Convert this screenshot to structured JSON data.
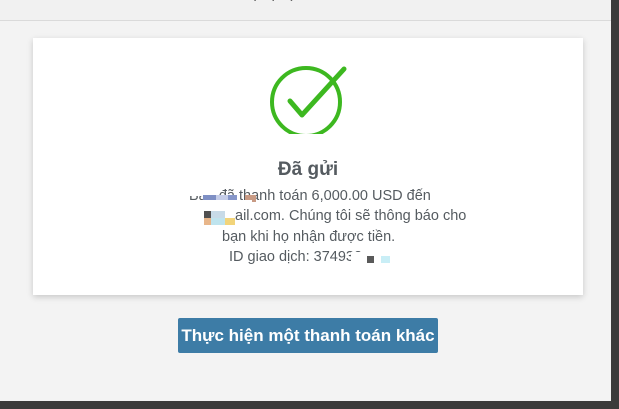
{
  "header": {
    "partial_text": "..."
  },
  "confirmation": {
    "icon": "check-circle-icon",
    "title": "Đã gửi",
    "line1": "Bạn đã thanh toán 6,000.00 USD đến",
    "line2": "ail.com. Chúng tôi sẽ thông báo cho",
    "line3": "bạn khi họ nhận được tiền.",
    "line4": "ID giao dịch: 374932",
    "accent_color": "#3db820"
  },
  "actions": {
    "new_payment_label": "Thực hiện một thanh toán khác",
    "button_color": "#3d7ca6"
  }
}
